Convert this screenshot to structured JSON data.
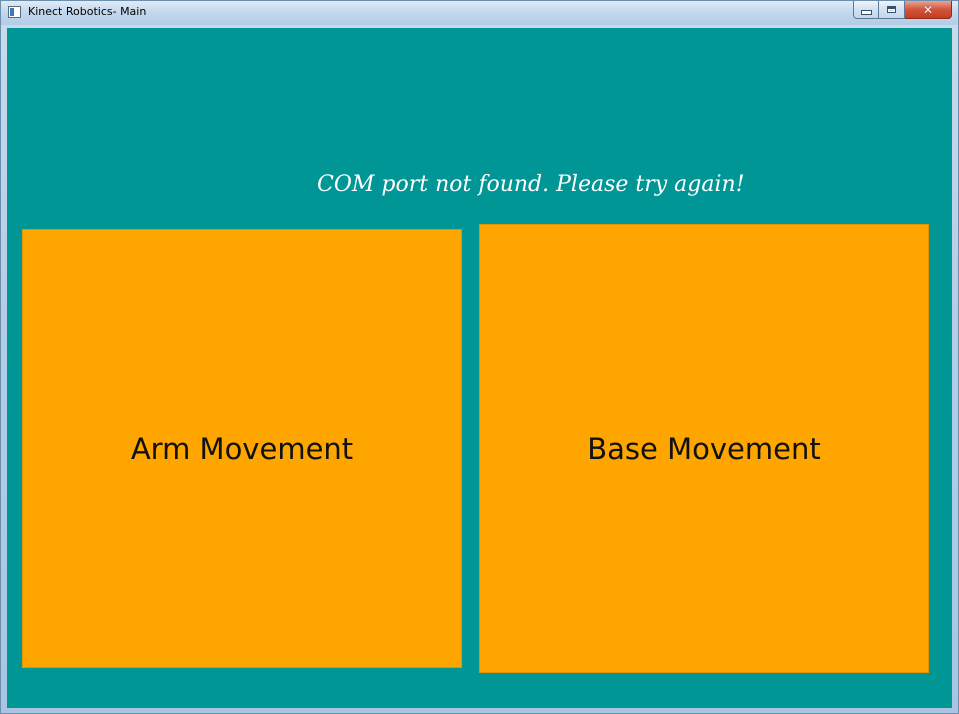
{
  "window": {
    "title": "Kinect Robotics- Main",
    "icon": "app-window-icon",
    "caption_buttons": {
      "minimize": "minimize-icon",
      "maximize": "maximize-icon",
      "close": "close-icon",
      "close_glyph": "✕"
    }
  },
  "main": {
    "status_message": "COM port not found. Please try again!",
    "tiles": [
      {
        "label": "Arm Movement"
      },
      {
        "label": "Base Movement"
      }
    ]
  },
  "colors": {
    "background": "#009696",
    "tile": "#ffa500",
    "message": "#ffffff",
    "tile_text": "#111111"
  }
}
